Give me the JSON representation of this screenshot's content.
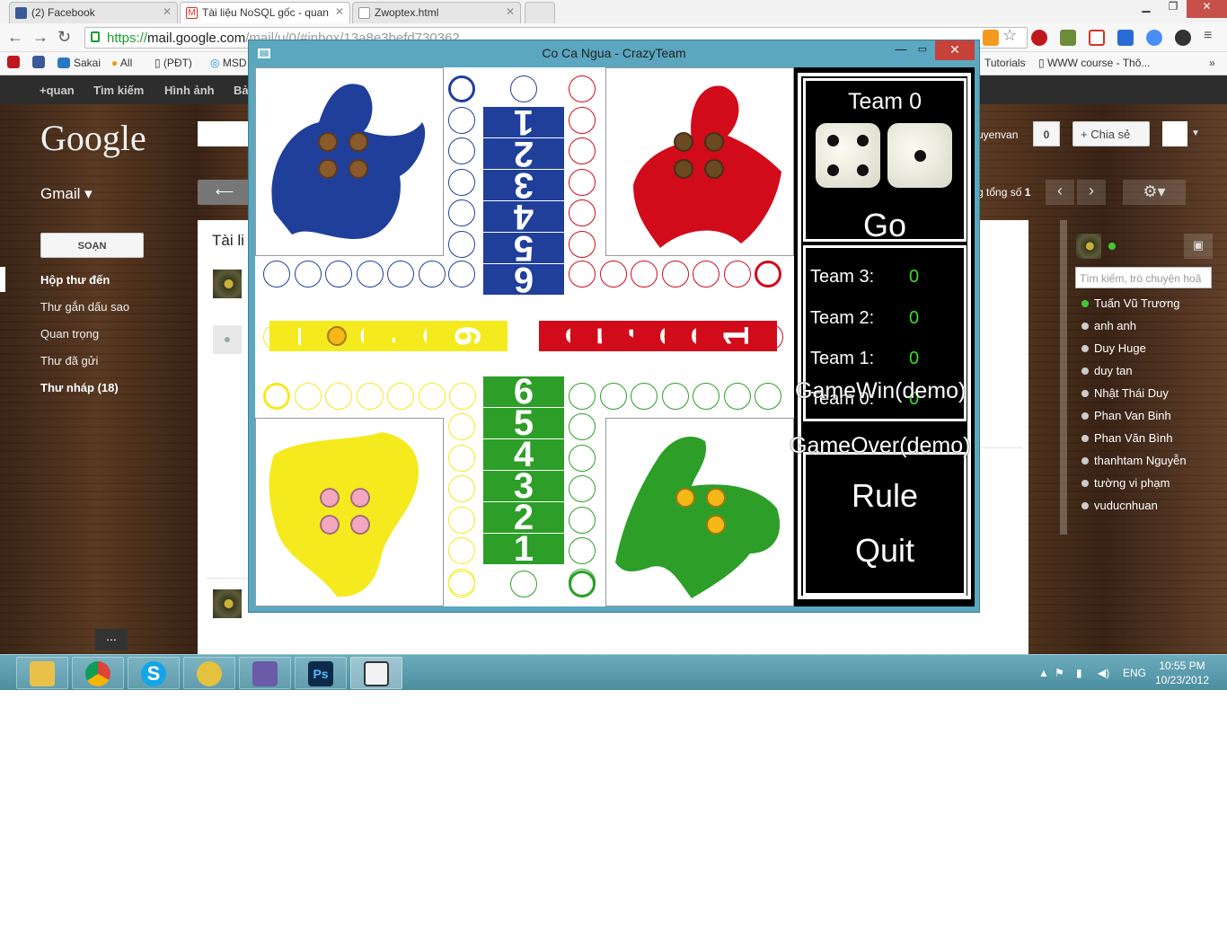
{
  "browser": {
    "tabs": [
      {
        "label": "(2) Facebook",
        "color": "#3b5998"
      },
      {
        "label": "Tài liệu NoSQL gốc - quan",
        "color": "#d93025"
      },
      {
        "label": "Zwoptex.html",
        "color": "#ffffff"
      }
    ],
    "url_https": "https://",
    "url_host": "mail.google.com",
    "url_path": "/mail/u/0/#inbox/13a8e3befd730362",
    "bookmarks": [
      "Sakai",
      "All",
      "(PĐT)",
      "MSD",
      "Tutorials",
      "WWW course - Thô..."
    ]
  },
  "gmail": {
    "top_links": [
      "+quan",
      "Tìm kiếm",
      "Hình ảnh",
      "Bả"
    ],
    "logo": "Google",
    "app_label": "Gmail ▾",
    "compose": "SOẠN",
    "nav": [
      {
        "label": "Hộp thư đến",
        "bold": true
      },
      {
        "label": "Thư gắn dấu sao",
        "bold": false
      },
      {
        "label": "Quan trọng",
        "bold": false
      },
      {
        "label": "Thư đã gửi",
        "bold": false
      },
      {
        "label": "Thư nháp (18)",
        "bold": true
      }
    ],
    "content_title": "Tài li",
    "user": "uyenvan",
    "count": "0",
    "share": "+ Chia sẻ",
    "page_info": "g tổng số ",
    "page_total": "1",
    "chat_search": "Tìm kiếm, trò chuyện hoặ",
    "contacts": [
      "Tuấn Vũ Trương",
      "anh anh",
      "Duy Huge",
      "duy tan",
      "Nhật Thái Duy",
      "Phan Van Binh",
      "Phan Văn Bình",
      "thanhtam Nguyễn",
      "tường vi phạm",
      "vuducnhuan"
    ],
    "more": "..."
  },
  "game": {
    "title": "Co Ca Ngua - CrazyTeam",
    "current_team": "Team 0",
    "dice": [
      4,
      1
    ],
    "go": "Go",
    "scores": [
      {
        "label": "Team 3:",
        "value": "0"
      },
      {
        "label": "Team 2:",
        "value": "0"
      },
      {
        "label": "Team 1:",
        "value": "0"
      },
      {
        "label": "Team 0:",
        "value": "0"
      }
    ],
    "game_win": "GameWin(demo)",
    "game_over": "GameOver(demo)",
    "rule": "Rule",
    "quit": "Quit",
    "numbers": [
      "1",
      "2",
      "3",
      "4",
      "5",
      "6"
    ],
    "colors": {
      "blue": "#1f3f9b",
      "red": "#d10b1a",
      "yellow": "#f5ea1e",
      "green": "#2d9e28"
    }
  },
  "taskbar": {
    "lang": "ENG",
    "time": "10:55 PM",
    "date": "10/23/2012"
  }
}
